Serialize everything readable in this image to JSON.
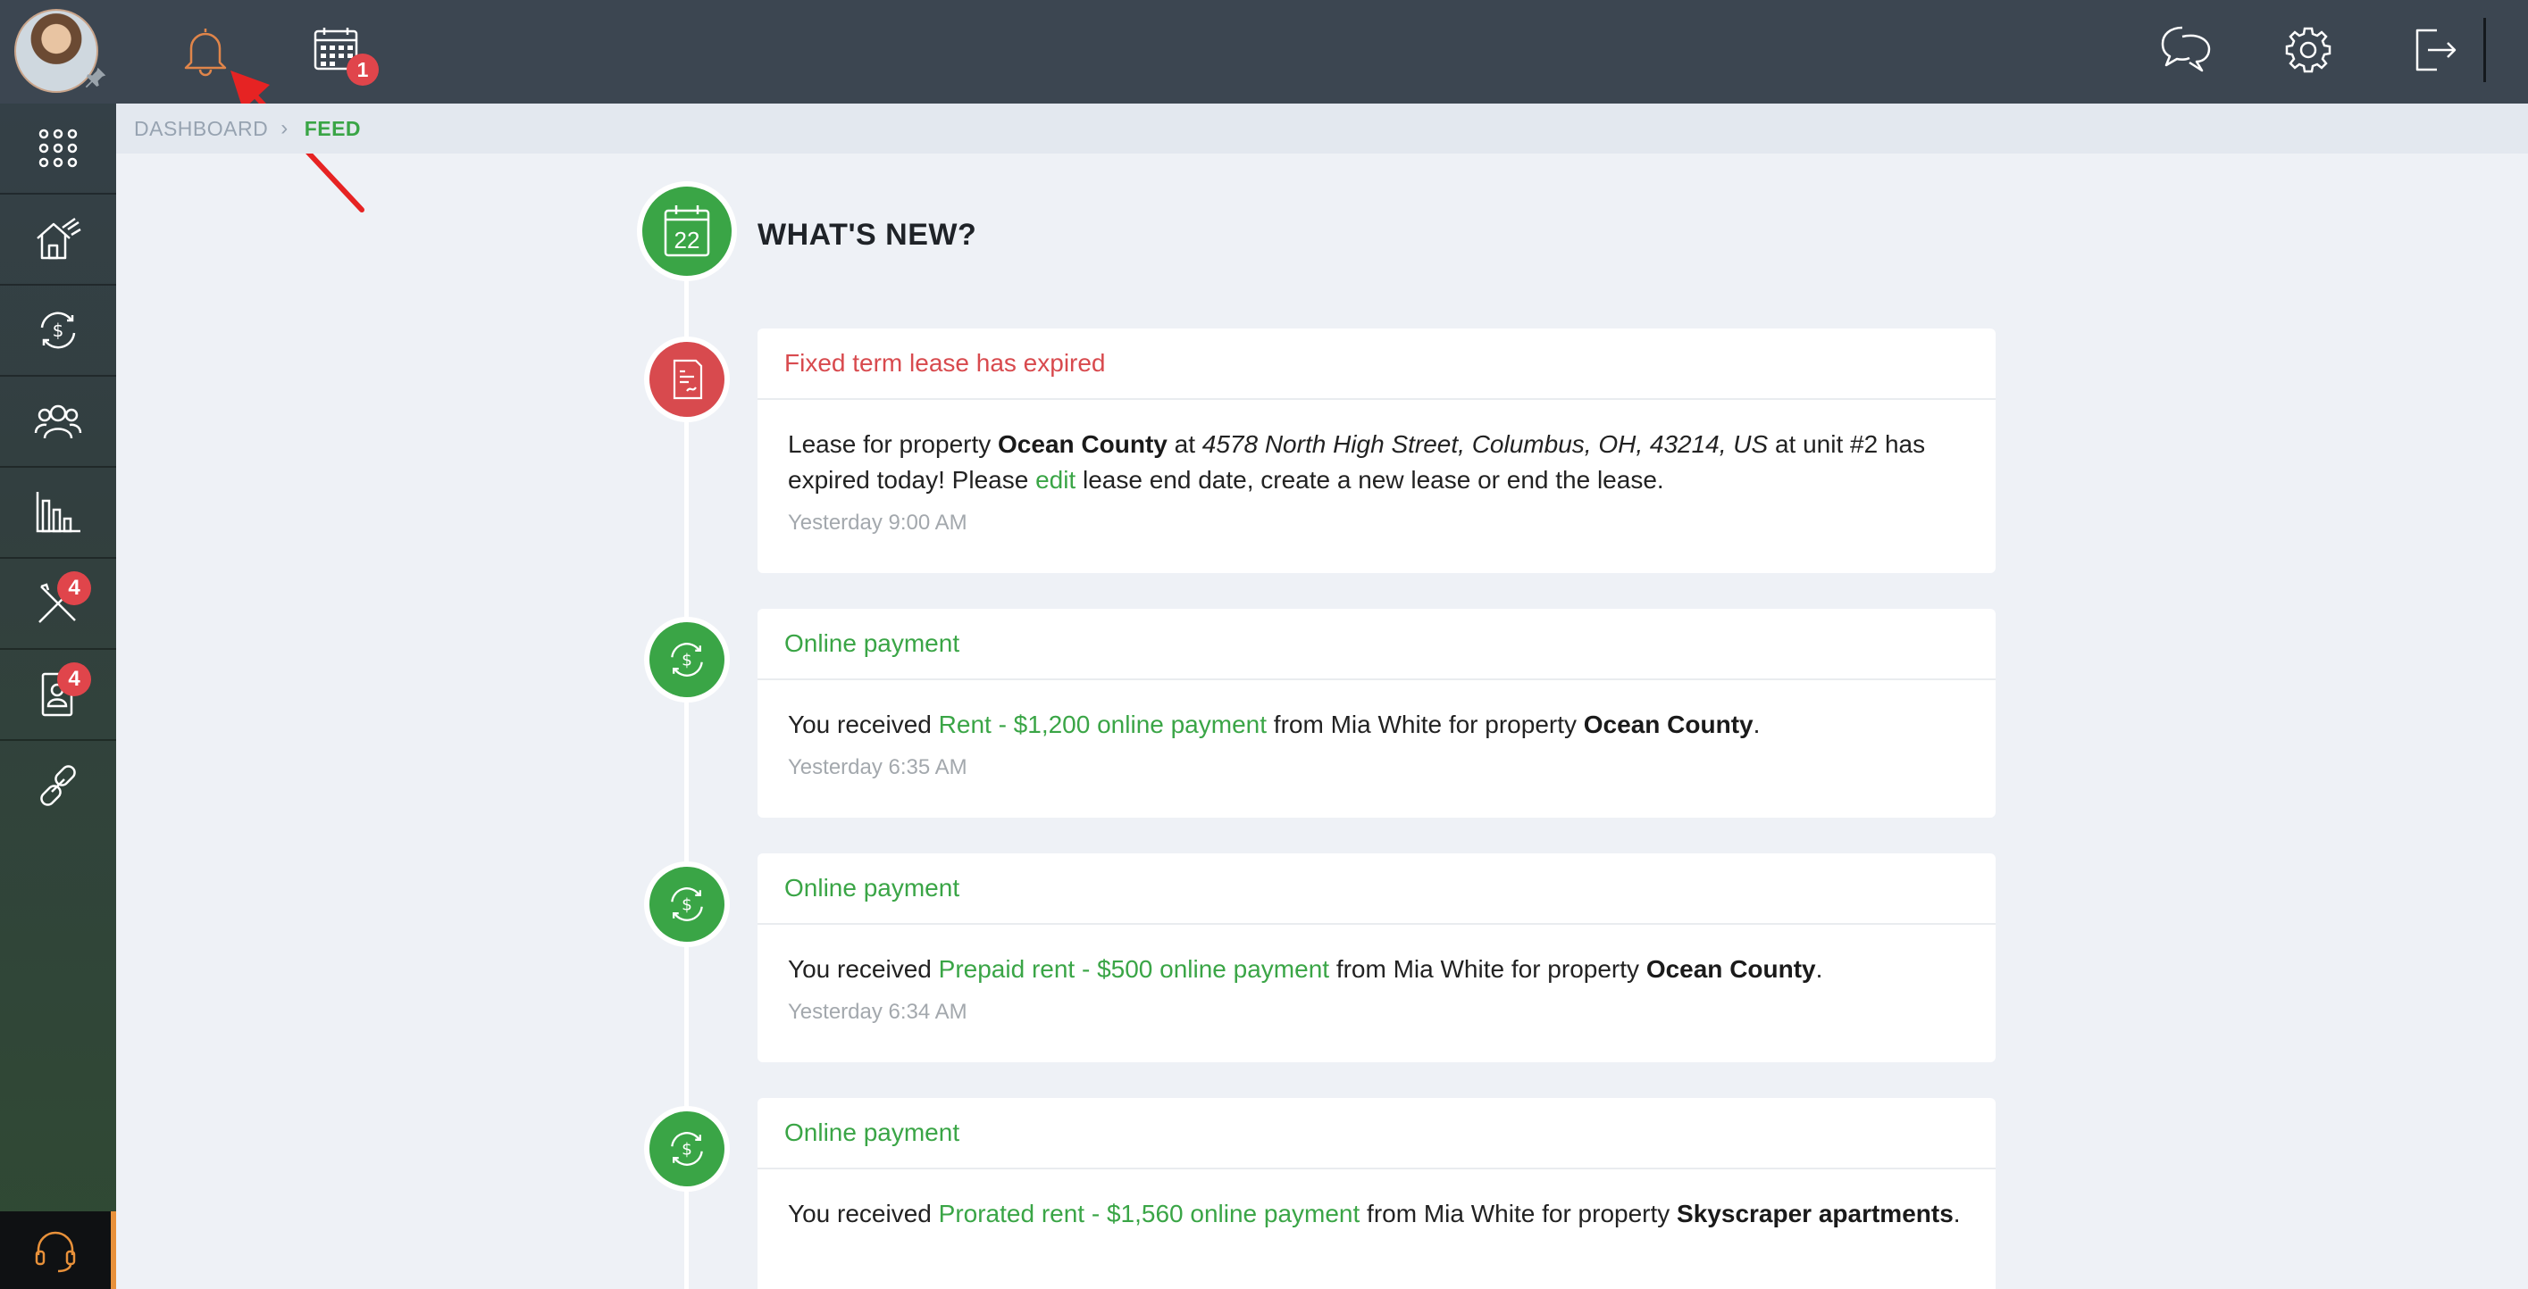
{
  "sidebar": {
    "badges": {
      "maintenance": "4",
      "applicants": "4"
    },
    "items": [
      {
        "icon": "apps-grid-icon"
      },
      {
        "icon": "properties-house-icon"
      },
      {
        "icon": "accounting-dollar-icon"
      },
      {
        "icon": "people-icon"
      },
      {
        "icon": "reports-chart-icon"
      },
      {
        "icon": "maintenance-tools-icon"
      },
      {
        "icon": "applicants-id-icon"
      },
      {
        "icon": "links-icon"
      }
    ],
    "support_icon": "headset-icon"
  },
  "topbar": {
    "calendar_badge": "1",
    "icons": [
      "bell-icon",
      "calendar-icon",
      "chat-icon",
      "gear-icon",
      "logout-icon"
    ]
  },
  "breadcrumb": {
    "dashboard": "DASHBOARD",
    "separator": "›",
    "current": "FEED"
  },
  "feed": {
    "title": "WHAT'S NEW?",
    "calendar_day": "22",
    "items": [
      {
        "type": "lease",
        "heading": "Fixed term lease has expired",
        "text_1": "Lease for property ",
        "property": "Ocean County",
        "text_2": " at ",
        "address": "4578 North High Street, Columbus, OH, 43214, US",
        "text_3": " at unit #2 has expired today! Please ",
        "link": "edit",
        "text_4": " lease end date, create a new lease or end the lease.",
        "time": "Yesterday 9:00 AM"
      },
      {
        "type": "payment",
        "heading": "Online payment",
        "text_1": "You received ",
        "link": "Rent - $1,200 online payment",
        "text_2": " from Mia White for property ",
        "property": "Ocean County",
        "text_3": ".",
        "time": "Yesterday 6:35 AM"
      },
      {
        "type": "payment",
        "heading": "Online payment",
        "text_1": "You received ",
        "link": "Prepaid rent - $500 online payment",
        "text_2": " from Mia White for property ",
        "property": "Ocean County",
        "text_3": ".",
        "time": "Yesterday 6:34 AM"
      },
      {
        "type": "payment",
        "heading": "Online payment",
        "text_1": "You received ",
        "link": "Prorated rent - $1,560 online payment",
        "text_2": " from Mia White for property ",
        "property": "Skyscraper apartments",
        "text_3": ".",
        "time": ""
      }
    ]
  },
  "colors": {
    "sidebar_top": "#354049",
    "sidebar_bottom": "#2f4a33",
    "topbar": "#3c4651",
    "accent_green": "#3aa546",
    "alert_red": "#d84a4e",
    "bell_orange": "#e0854a",
    "badge_red": "#e0454b",
    "page_bg": "#eef1f6"
  }
}
